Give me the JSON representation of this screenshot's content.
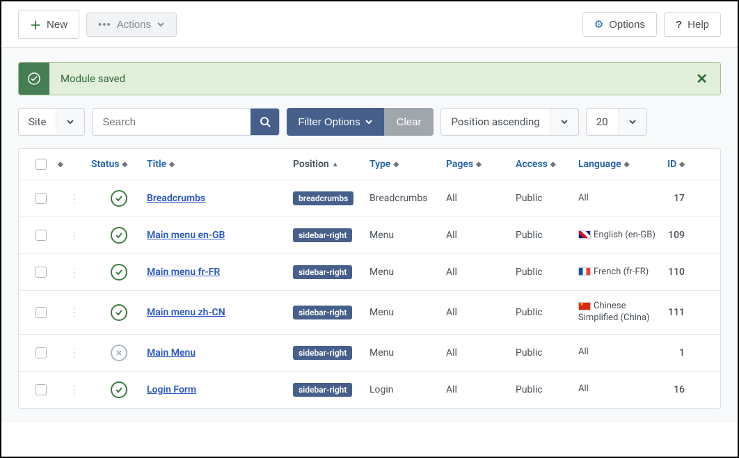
{
  "toolbar": {
    "new_label": "New",
    "actions_label": "Actions",
    "options_label": "Options",
    "help_label": "Help"
  },
  "alert": {
    "message": "Module saved"
  },
  "filters": {
    "site_label": "Site",
    "search_placeholder": "Search",
    "filter_options_label": "Filter Options",
    "clear_label": "Clear",
    "sort_label": "Position ascending",
    "limit_label": "20"
  },
  "columns": {
    "status": "Status",
    "title": "Title",
    "position": "Position",
    "type": "Type",
    "pages": "Pages",
    "access": "Access",
    "language": "Language",
    "id": "ID"
  },
  "rows": [
    {
      "status": "published",
      "title": "Breadcrumbs",
      "position": "breadcrumbs",
      "type": "Breadcrumbs",
      "pages": "All",
      "access": "Public",
      "language": "All",
      "flag": "",
      "id": "17"
    },
    {
      "status": "published",
      "title": "Main menu en-GB",
      "position": "sidebar-right",
      "type": "Menu",
      "pages": "All",
      "access": "Public",
      "language": "English (en-GB)",
      "flag": "gb",
      "id": "109"
    },
    {
      "status": "published",
      "title": "Main menu fr-FR",
      "position": "sidebar-right",
      "type": "Menu",
      "pages": "All",
      "access": "Public",
      "language": "French (fr-FR)",
      "flag": "fr",
      "id": "110"
    },
    {
      "status": "published",
      "title": "Main menu zh-CN",
      "position": "sidebar-right",
      "type": "Menu",
      "pages": "All",
      "access": "Public",
      "language": "Chinese Simplified (China)",
      "flag": "cn",
      "id": "111"
    },
    {
      "status": "unpublished",
      "title": "Main Menu",
      "position": "sidebar-right",
      "type": "Menu",
      "pages": "All",
      "access": "Public",
      "language": "All",
      "flag": "",
      "id": "1"
    },
    {
      "status": "published",
      "title": "Login Form",
      "position": "sidebar-right",
      "type": "Login",
      "pages": "All",
      "access": "Public",
      "language": "All",
      "flag": "",
      "id": "16"
    }
  ]
}
